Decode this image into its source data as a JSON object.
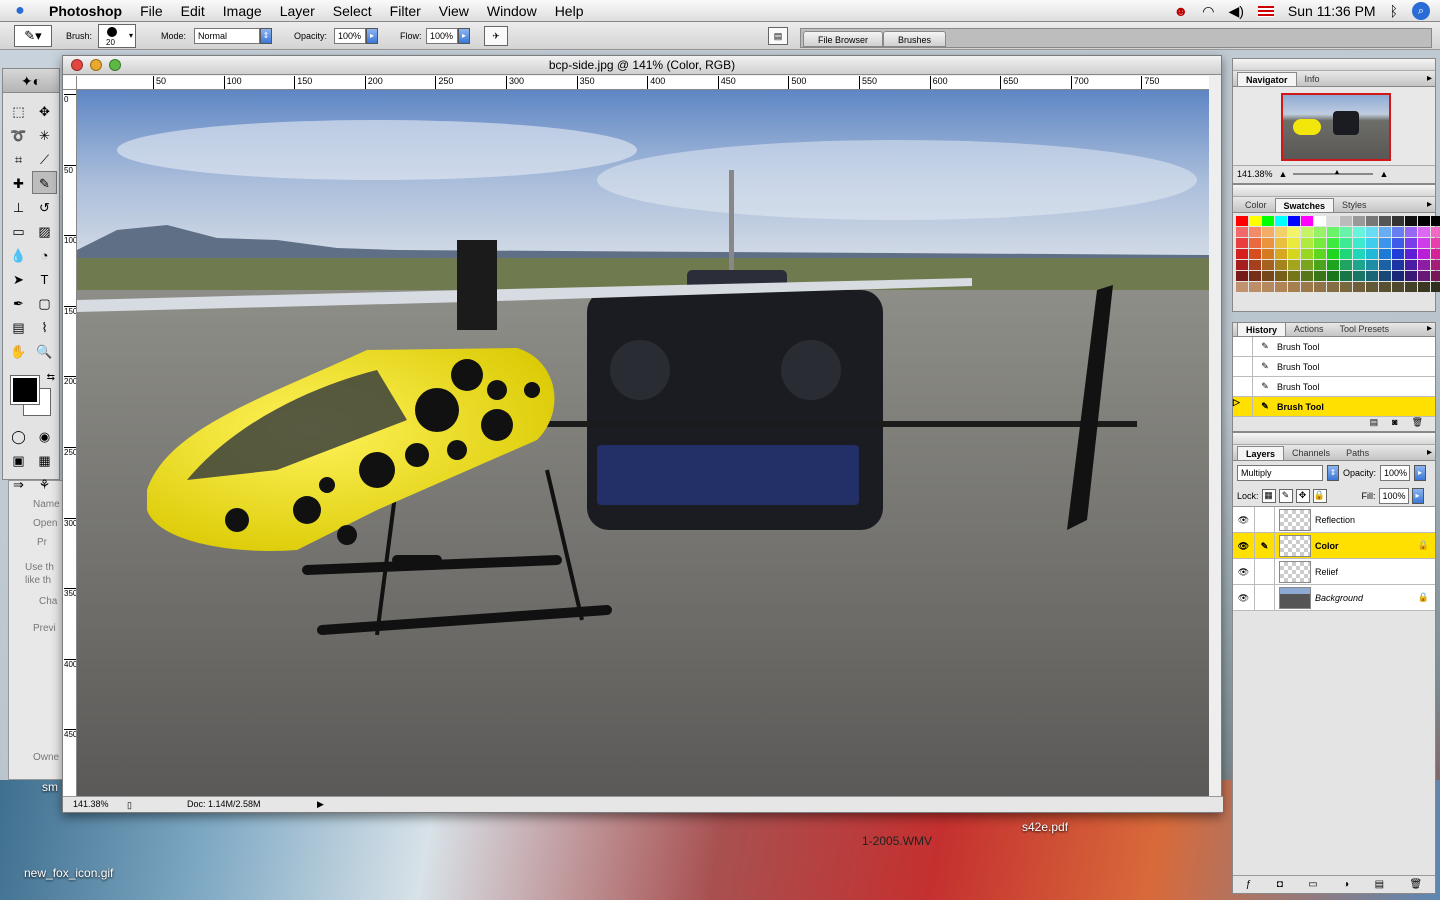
{
  "menubar": {
    "app": "Photoshop",
    "items": [
      "File",
      "Edit",
      "Image",
      "Layer",
      "Select",
      "Filter",
      "View",
      "Window",
      "Help"
    ],
    "clock": "Sun 11:36 PM"
  },
  "options": {
    "brush_label": "Brush:",
    "brush_size": "20",
    "mode_label": "Mode:",
    "mode_value": "Normal",
    "opacity_label": "Opacity:",
    "opacity_value": "100%",
    "flow_label": "Flow:",
    "flow_value": "100%"
  },
  "palette_well": {
    "tabs": [
      "File Browser",
      "Brushes"
    ]
  },
  "document": {
    "title": "bcp-side.jpg @ 141% (Color, RGB)",
    "ruler_h": [
      "50",
      "100",
      "150",
      "200",
      "250",
      "300",
      "350",
      "400",
      "450",
      "500",
      "550",
      "600",
      "650",
      "700",
      "750"
    ],
    "ruler_v": [
      "0",
      "50",
      "100",
      "150",
      "200",
      "250",
      "300",
      "350",
      "400",
      "450"
    ],
    "zoom": "141.38%",
    "doc_size": "Doc: 1.14M/2.58M"
  },
  "navigator": {
    "tabs": [
      "Navigator",
      "Info"
    ],
    "zoom": "141.38%"
  },
  "swatches": {
    "tabs": [
      "Color",
      "Swatches",
      "Styles"
    ]
  },
  "history": {
    "tabs": [
      "History",
      "Actions",
      "Tool Presets"
    ],
    "items": [
      "Brush Tool",
      "Brush Tool",
      "Brush Tool",
      "Brush Tool"
    ]
  },
  "layers": {
    "tabs": [
      "Layers",
      "Channels",
      "Paths"
    ],
    "blend_mode": "Multiply",
    "opacity_label": "Opacity:",
    "opacity": "100%",
    "lock_label": "Lock:",
    "fill_label": "Fill:",
    "fill": "100%",
    "items": [
      "Reflection",
      "Color",
      "Relief",
      "Background"
    ]
  },
  "file_browser_back": {
    "items": [
      "Name",
      "Open",
      "Pr",
      "Use th",
      "like th",
      "Cha",
      "Previ",
      "Owne"
    ]
  },
  "desktop": {
    "icons": [
      "new_fox_icon.gif",
      "s42e.pdf",
      "1-2005.WMV",
      "sm"
    ]
  },
  "colors": {
    "selection": "#ffe000",
    "helicopter": "#f2e60a"
  }
}
